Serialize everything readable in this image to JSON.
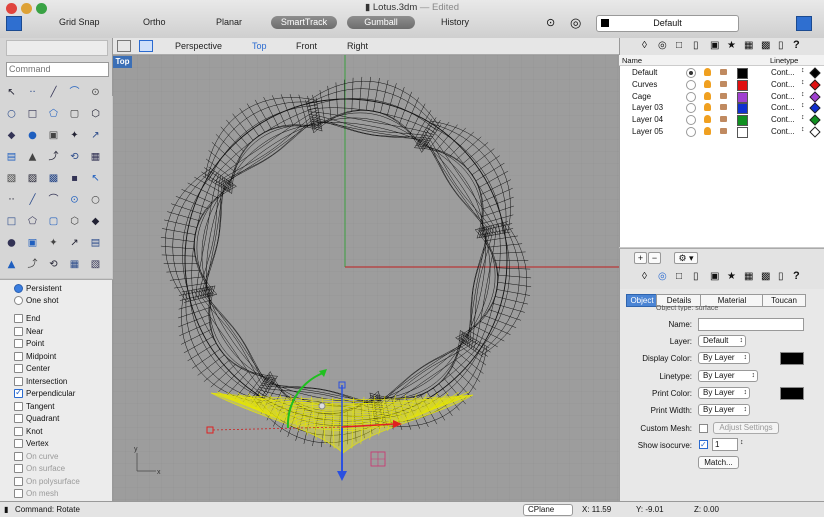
{
  "window": {
    "title": "Lotus.3dm",
    "edited": "— Edited"
  },
  "toolbar": {
    "grid_snap": "Grid Snap",
    "ortho": "Ortho",
    "planar": "Planar",
    "smarttrack": "SmartTrack",
    "gumball": "Gumball",
    "history": "History",
    "current_layer": "Default"
  },
  "command": {
    "placeholder": "Command"
  },
  "viewport_tabs": [
    "Perspective",
    "Top",
    "Front",
    "Right"
  ],
  "viewport": {
    "label": "Top",
    "axis_x": "x",
    "axis_y": "y"
  },
  "osnap": {
    "modes": [
      "Persistent",
      "One shot"
    ],
    "items": [
      {
        "label": "End",
        "checked": false,
        "enabled": true
      },
      {
        "label": "Near",
        "checked": false,
        "enabled": true
      },
      {
        "label": "Point",
        "checked": false,
        "enabled": true
      },
      {
        "label": "Midpoint",
        "checked": false,
        "enabled": true
      },
      {
        "label": "Center",
        "checked": false,
        "enabled": true
      },
      {
        "label": "Intersection",
        "checked": false,
        "enabled": true
      },
      {
        "label": "Perpendicular",
        "checked": true,
        "enabled": true
      },
      {
        "label": "Tangent",
        "checked": false,
        "enabled": true
      },
      {
        "label": "Quadrant",
        "checked": false,
        "enabled": true
      },
      {
        "label": "Knot",
        "checked": false,
        "enabled": true
      },
      {
        "label": "Vertex",
        "checked": false,
        "enabled": true
      },
      {
        "label": "On curve",
        "checked": false,
        "enabled": false
      },
      {
        "label": "On surface",
        "checked": false,
        "enabled": false
      },
      {
        "label": "On polysurface",
        "checked": false,
        "enabled": false
      },
      {
        "label": "On mesh",
        "checked": false,
        "enabled": false
      }
    ]
  },
  "layers": {
    "headers": {
      "name": "Name",
      "linetype": "Linetype"
    },
    "rows": [
      {
        "name": "Default",
        "color": "#000000",
        "linetype": "Cont...",
        "current": true
      },
      {
        "name": "Curves",
        "color": "#e01010",
        "linetype": "Cont...",
        "current": false
      },
      {
        "name": "Cage",
        "color": "#a040d0",
        "linetype": "Cont...",
        "current": false
      },
      {
        "name": "Layer 03",
        "color": "#1030d0",
        "linetype": "Cont...",
        "current": false
      },
      {
        "name": "Layer 04",
        "color": "#109020",
        "linetype": "Cont...",
        "current": false
      },
      {
        "name": "Layer 05",
        "color": "#ffffff",
        "linetype": "Cont...",
        "current": false
      }
    ],
    "add": "+",
    "remove": "−",
    "gear": "⚙ ▾"
  },
  "properties": {
    "tabs": [
      "Object",
      "Details",
      "Material",
      "Toucan"
    ],
    "object_type": "Object type:  surface",
    "name_label": "Name:",
    "layer_label": "Layer:",
    "layer_value": "Default",
    "display_color_label": "Display Color:",
    "display_color_value": "By Layer",
    "linetype_label": "Linetype:",
    "linetype_value": "By Layer",
    "print_color_label": "Print Color:",
    "print_color_value": "By Layer",
    "print_width_label": "Print Width:",
    "print_width_value": "By Layer",
    "custom_mesh_label": "Custom Mesh:",
    "adjust_settings": "Adjust Settings",
    "show_isocurve_label": "Show isocurve:",
    "isocurve_value": "1",
    "match": "Match..."
  },
  "status": {
    "command": "Command: Rotate",
    "cplane": "CPlane",
    "x": "X: 11.59",
    "y": "Y: -9.01",
    "z": "Z: 0.00"
  },
  "colors": {
    "accent": "#4a84d4",
    "viewport_bg": "#9d9d9d",
    "selection": "#ffff00"
  }
}
